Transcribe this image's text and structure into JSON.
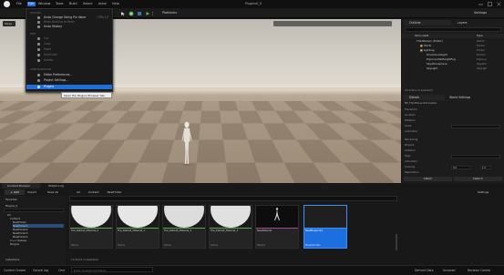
{
  "window": {
    "project_title": "Plugins0_0"
  },
  "menubar": {
    "items": [
      "File",
      "Edit",
      "Window",
      "Tools",
      "Build",
      "Select",
      "Actor",
      "Help"
    ],
    "active": "Edit"
  },
  "toolbar": {
    "platforms_label": "Platforms",
    "settings_label": "Settings"
  },
  "edit_menu": {
    "items": [
      {
        "label": "Undo Change String Pin Value",
        "shortcut": "CTRL+Z",
        "disabled": false
      },
      {
        "label": "Redo Nothing to Redo",
        "shortcut": "",
        "disabled": true
      },
      {
        "label": "Undo History",
        "shortcut": "",
        "disabled": false
      },
      {
        "label": "Cut",
        "shortcut": "",
        "disabled": true
      },
      {
        "label": "Copy",
        "shortcut": "",
        "disabled": true
      },
      {
        "label": "Paste",
        "shortcut": "",
        "disabled": true
      },
      {
        "label": "Duplicate",
        "shortcut": "",
        "disabled": true
      },
      {
        "label": "Delete",
        "shortcut": "",
        "disabled": true
      },
      {
        "label": "Editor Preferences...",
        "shortcut": "",
        "disabled": false
      },
      {
        "label": "Project Settings...",
        "shortcut": "",
        "disabled": false
      },
      {
        "label": "Plugins",
        "shortcut": "",
        "disabled": false,
        "highlighted": true
      }
    ],
    "tooltip": "Open the Plugins Browser tab."
  },
  "viewport": {
    "perspective_label": "Persp"
  },
  "outliner": {
    "tabs": [
      "Outliner",
      "Layers"
    ],
    "column_label": "Item Label",
    "column_type": "Type",
    "rows": [
      {
        "label": "ThirdPerson (Editor)",
        "type": "World",
        "indent": 1
      },
      {
        "label": "HLOD",
        "type": "Folder",
        "indent": 2
      },
      {
        "label": "Lighting",
        "type": "Folder",
        "indent": 2
      },
      {
        "label": "DirectionalLight",
        "type": "Directi",
        "indent": 3
      },
      {
        "label": "ExponentialHeightFog",
        "type": "Expone",
        "indent": 3
      },
      {
        "label": "SkyAtmosphere",
        "type": "SkyAtm",
        "indent": 3
      },
      {
        "label": "SkyLight",
        "type": "SkyLigh",
        "indent": 3
      }
    ],
    "footer": "14 actors (1 selected)"
  },
  "details": {
    "tabs": [
      "Details",
      "World Settings"
    ],
    "object": "BP_ThirdPersonCharacter",
    "search_placeholder": "Search",
    "rows": [
      "Transform",
      "Location",
      "Rotation",
      "Scale",
      "Animation",
      "Rendering",
      "Physics",
      "Collision",
      "Tags",
      "Activation",
      "Cooking",
      "Replication"
    ],
    "values": [
      "0.0",
      "0.0",
      "1.0"
    ],
    "attach_label": "Attach",
    "detach_label": "Detach",
    "blank_label": "Blank",
    "none_label": "None"
  },
  "content_browser": {
    "tabs": [
      "Content Browser",
      "Output Log"
    ],
    "add_label": "+ Add",
    "import_label": "Import",
    "save_all_label": "Save All",
    "breadcrumb": [
      "All",
      "Content",
      "NewFolder"
    ],
    "settings_label": "Settings",
    "favorites_label": "Favorites",
    "project_label": "Plugins_0",
    "tree": [
      "All",
      "Content",
      "NewFolder",
      "NewFolder1",
      "NewFolder2",
      "NewFolder3",
      "NewFolder4",
      "C++ Classes",
      "Plugins"
    ],
    "assets": [
      {
        "label": "Tile_Default_Material_0",
        "type": "Texture"
      },
      {
        "label": "Tile_Default_Material_1",
        "type": "Texture"
      },
      {
        "label": "Tile_Default_Material_2",
        "type": "Texture"
      },
      {
        "label": "Tile_Default_Material_3",
        "type": "Texture"
      },
      {
        "label": "NewMaterial",
        "type": "Material"
      },
      {
        "label": "NewBlueprint1",
        "type": "Blueprint Class"
      }
    ],
    "footer": "12 items (1 selected)",
    "collections_label": "Collections"
  },
  "statusbar": {
    "left": [
      "Content Drawer",
      "Output Log",
      "Cmd"
    ],
    "cmd_placeholder": "Enter Console Command",
    "right": [
      "Derived Data",
      "Unsaved",
      "Revision Control"
    ]
  },
  "colors": {
    "accent": "#1f6fd8",
    "selected_asset": "#1d6fe0"
  }
}
